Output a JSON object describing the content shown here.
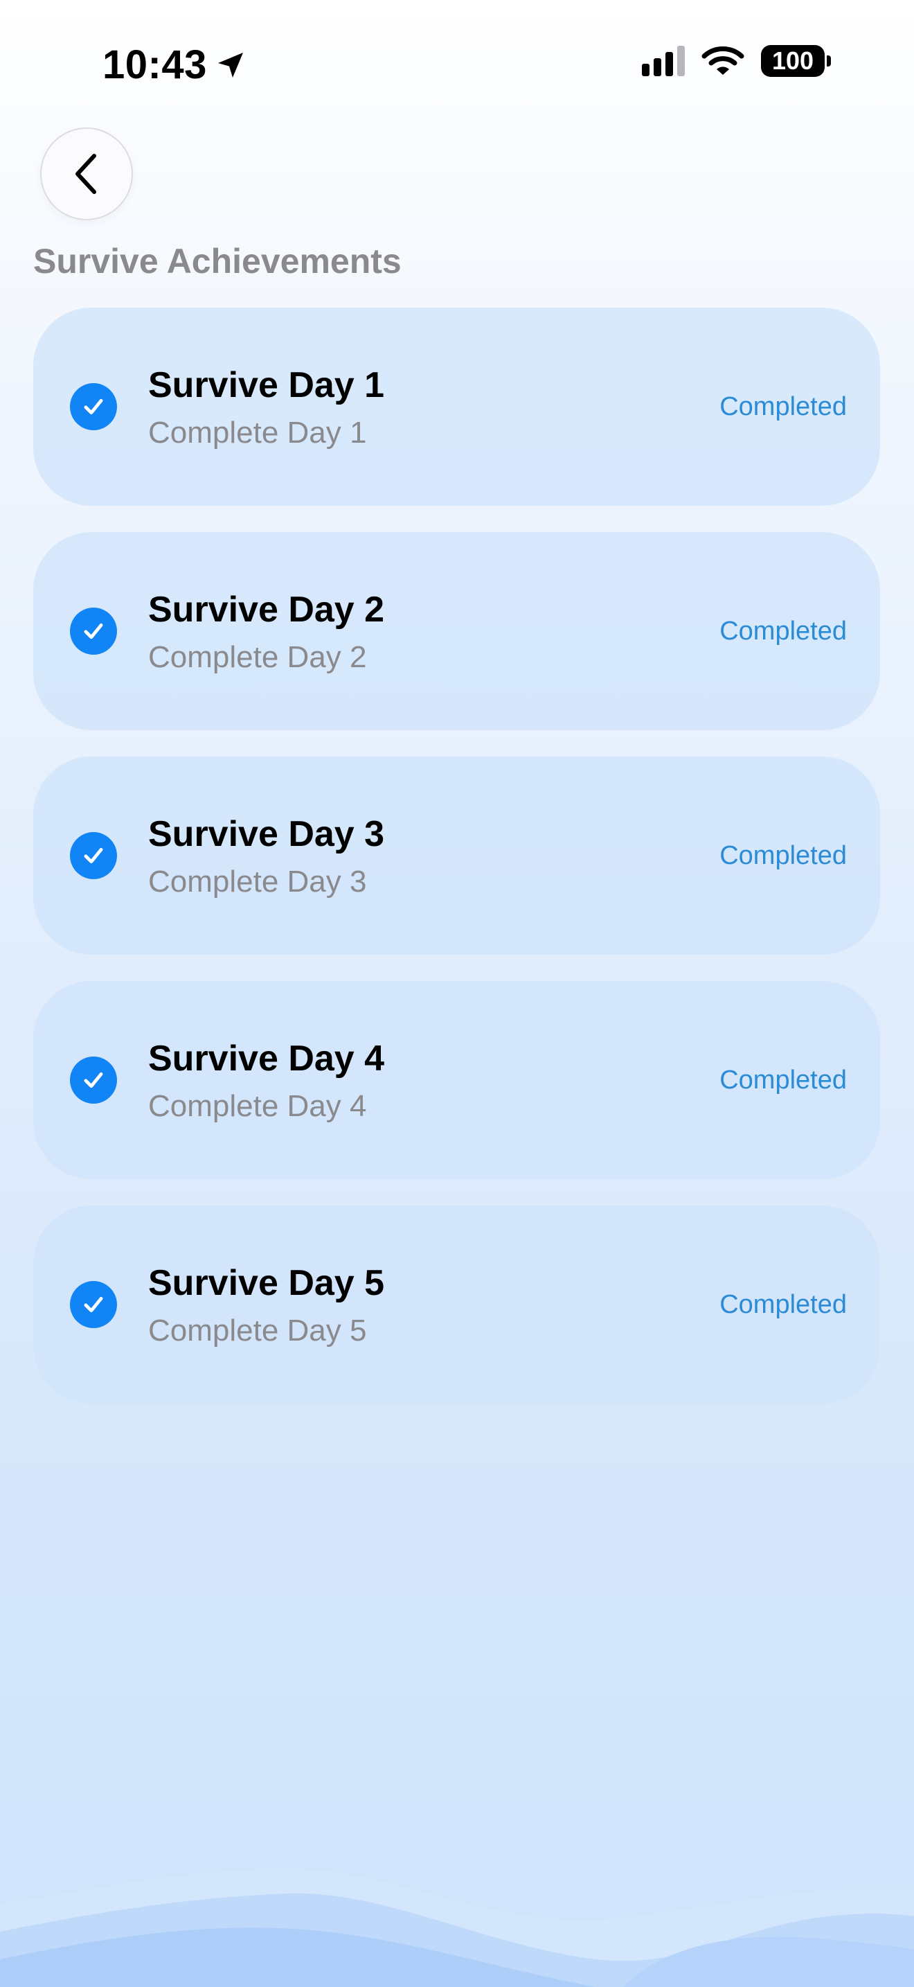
{
  "status_bar": {
    "time": "10:43",
    "battery": "100",
    "icons": [
      "location-arrow-icon",
      "cellular-signal-icon",
      "wifi-icon",
      "battery-icon"
    ]
  },
  "header": {
    "back_icon": "chevron-left-icon",
    "title": "Survive Achievements"
  },
  "achievements": [
    {
      "title": "Survive Day 1",
      "subtitle": "Complete Day 1",
      "status": "Completed"
    },
    {
      "title": "Survive Day 2",
      "subtitle": "Complete Day 2",
      "status": "Completed"
    },
    {
      "title": "Survive Day 3",
      "subtitle": "Complete Day 3",
      "status": "Completed"
    },
    {
      "title": "Survive Day 4",
      "subtitle": "Complete Day 4",
      "status": "Completed"
    },
    {
      "title": "Survive Day 5",
      "subtitle": "Complete Day 5",
      "status": "Completed"
    }
  ],
  "colors": {
    "accent": "#1185F6",
    "status_text": "#2B8BD5",
    "card_background": "#CFE3FB",
    "secondary_text": "#8A8A8E"
  }
}
